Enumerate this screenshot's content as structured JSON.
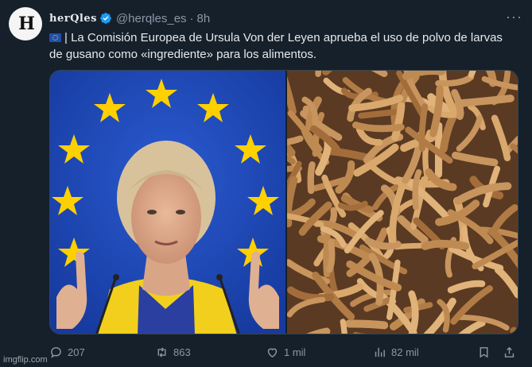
{
  "tweet": {
    "author_name": "herQles",
    "handle": "@herqles_es",
    "separator": "·",
    "time": "8h",
    "more_label": "···",
    "text": "| La Comisión Europea de Ursula Von der Leyen aprueba el uso de polvo de larvas de gusano como «ingrediente» para los alimentos.",
    "flag_icon": "eu-flag-icon"
  },
  "actions": {
    "replies": "207",
    "retweets": "863",
    "likes": "1 mil",
    "views": "82 mil"
  },
  "watermark": "imgflip.com",
  "colors": {
    "background": "#15202b",
    "text": "#e7e9ea",
    "muted": "#8b98a5",
    "verified": "#1d9bf0",
    "eu_blue": "#1f45b6",
    "eu_star": "#ffd000"
  }
}
